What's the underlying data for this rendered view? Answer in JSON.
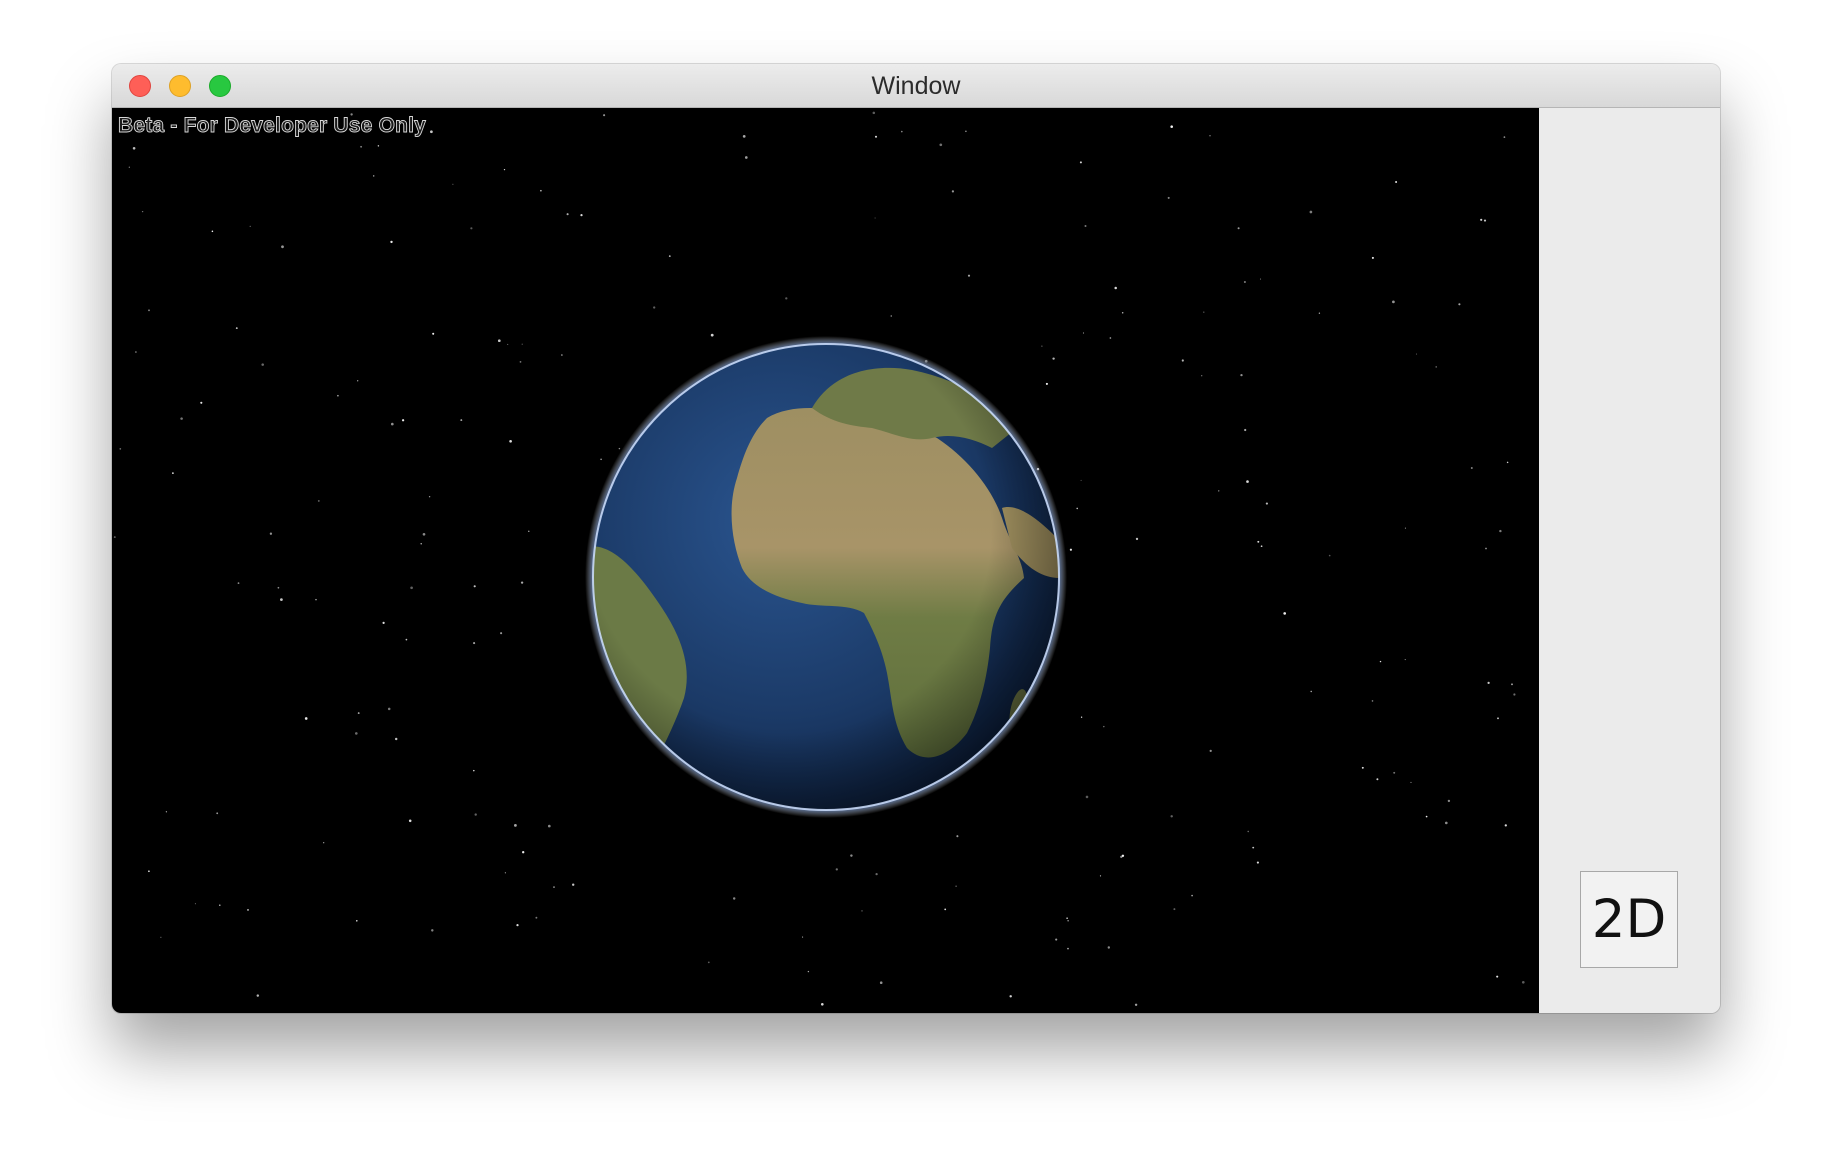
{
  "window": {
    "title": "Window",
    "traffic_lights": [
      {
        "name": "close",
        "color": "#fe5f57"
      },
      {
        "name": "minimize",
        "color": "#febc2e"
      },
      {
        "name": "zoom",
        "color": "#28c840"
      }
    ]
  },
  "scene": {
    "watermark": "Beta - For Developer Use Only",
    "background_color": "#000000",
    "globe": {
      "icon": "earth-globe",
      "ocean_color": "#1c3a66",
      "land_color": "#8a8256",
      "atmosphere_color": "#7fa8ff"
    }
  },
  "sidebar": {
    "view_toggle_label": "2D"
  }
}
